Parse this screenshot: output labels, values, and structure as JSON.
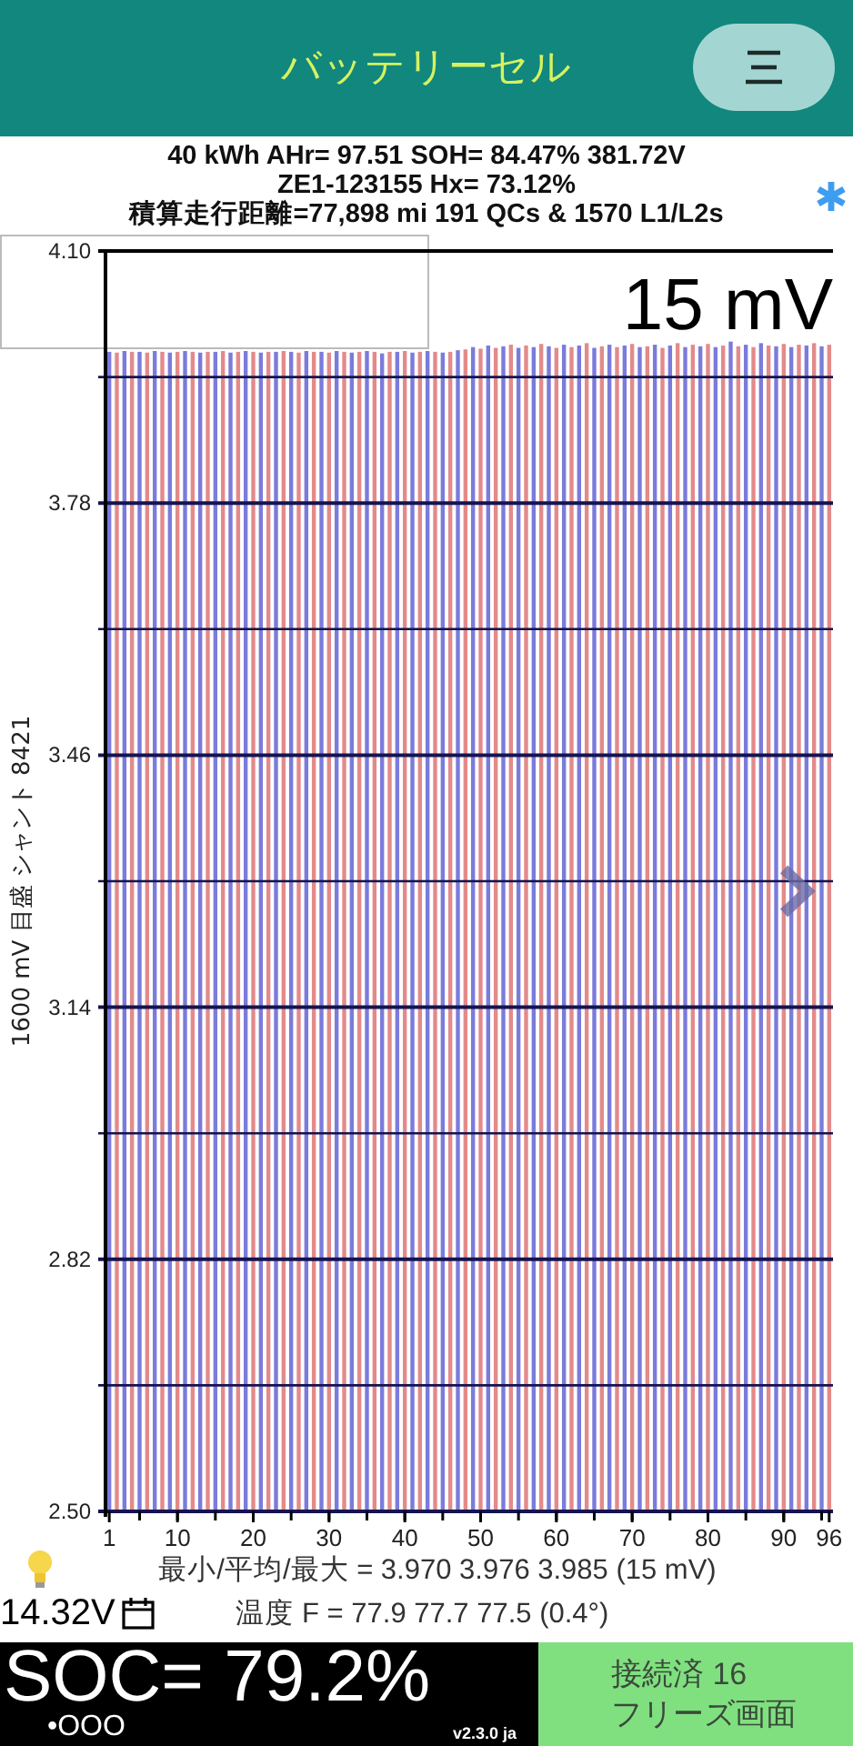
{
  "header": {
    "title": "バッテリーセル"
  },
  "summary": [
    "40 kWh  AHr= 97.51  SOH= 84.47%   381.72V",
    "ZE1-123155   Hx= 73.12%",
    "積算走行距離=77,898 mi 191 QCs & 1570 L1/L2s"
  ],
  "chart": {
    "spread_label": "15 mV",
    "chart_data": {
      "type": "bar",
      "ylabel": "1600 mV 目盛  シャント 8421",
      "grid": true,
      "ref_lines": [
        {
          "axis": "y",
          "value": 2.66
        },
        {
          "axis": "y",
          "value": 2.98
        },
        {
          "axis": "y",
          "value": 3.3
        },
        {
          "axis": "y",
          "value": 3.62
        },
        {
          "axis": "y",
          "value": 3.94
        }
      ],
      "x": [
        1,
        2,
        3,
        4,
        5,
        6,
        7,
        8,
        9,
        10,
        11,
        12,
        13,
        14,
        15,
        16,
        17,
        18,
        19,
        20,
        21,
        22,
        23,
        24,
        25,
        26,
        27,
        28,
        29,
        30,
        31,
        32,
        33,
        34,
        35,
        36,
        37,
        38,
        39,
        40,
        41,
        42,
        43,
        44,
        45,
        46,
        47,
        48,
        49,
        50,
        51,
        52,
        53,
        54,
        55,
        56,
        57,
        58,
        59,
        60,
        61,
        62,
        63,
        64,
        65,
        66,
        67,
        68,
        69,
        70,
        71,
        72,
        73,
        74,
        75,
        76,
        77,
        78,
        79,
        80,
        81,
        82,
        83,
        84,
        85,
        86,
        87,
        88,
        89,
        90,
        91,
        92,
        93,
        94,
        95,
        96
      ],
      "xlim": [
        0.5,
        96.5
      ],
      "ylim": [
        2.5,
        4.1
      ],
      "xticks": [
        1,
        10,
        20,
        30,
        40,
        50,
        60,
        70,
        80,
        90,
        96
      ],
      "yticks": [
        {
          "value": 2.5,
          "label": "2.50"
        },
        {
          "value": 2.82,
          "label": "2.82"
        },
        {
          "value": 3.14,
          "label": "3.14"
        },
        {
          "value": 3.46,
          "label": "3.46"
        },
        {
          "value": 3.78,
          "label": "3.78"
        },
        {
          "value": 4.1,
          "label": "4.10"
        }
      ],
      "series": [
        {
          "color": "#7b7bdc",
          "values": [
            3.972,
            null,
            3.973,
            null,
            3.972,
            null,
            3.973,
            null,
            3.971,
            null,
            3.973,
            null,
            3.971,
            null,
            3.972,
            null,
            3.971,
            null,
            3.973,
            null,
            3.971,
            null,
            3.972,
            null,
            3.972,
            null,
            3.973,
            null,
            3.972,
            null,
            3.973,
            null,
            3.971,
            null,
            3.973,
            null,
            3.97,
            null,
            3.972,
            null,
            3.971,
            null,
            3.973,
            null,
            3.971,
            null,
            3.974,
            null,
            3.978,
            null,
            3.98,
            null,
            3.979,
            null,
            3.977,
            null,
            3.978,
            null,
            3.979,
            null,
            3.981,
            null,
            3.98,
            null,
            3.977,
            null,
            3.981,
            null,
            3.98,
            null,
            3.978,
            null,
            3.981,
            null,
            3.98,
            null,
            3.978,
            null,
            3.979,
            null,
            3.978,
            null,
            3.985,
            null,
            3.981,
            null,
            3.983,
            null,
            3.979,
            null,
            3.978,
            null,
            3.98,
            null,
            3.979,
            null
          ]
        },
        {
          "color": "#e38a8a",
          "values": [
            null,
            3.971,
            null,
            3.972,
            null,
            3.971,
            null,
            3.972,
            null,
            3.972,
            null,
            3.972,
            null,
            3.972,
            null,
            3.973,
            null,
            3.972,
            null,
            3.972,
            null,
            3.972,
            null,
            3.973,
            null,
            3.971,
            null,
            3.972,
            null,
            3.971,
            null,
            3.972,
            null,
            3.972,
            null,
            3.972,
            null,
            3.972,
            null,
            3.973,
            null,
            3.972,
            null,
            3.972,
            null,
            3.972,
            null,
            3.975,
            null,
            3.976,
            null,
            3.977,
            null,
            3.981,
            null,
            3.98,
            null,
            3.982,
            null,
            3.977,
            null,
            3.978,
            null,
            3.983,
            null,
            3.979,
            null,
            3.978,
            null,
            3.982,
            null,
            3.979,
            null,
            3.977,
            null,
            3.983,
            null,
            3.981,
            null,
            3.982,
            null,
            3.98,
            null,
            3.979,
            null,
            3.978,
            null,
            3.98,
            null,
            3.982,
            null,
            3.981,
            null,
            3.983,
            null,
            3.981
          ]
        }
      ]
    }
  },
  "stats": [
    "最小/平均/最大 = 3.970 3.976 3.985  (15 mV)",
    "温度 F = 77.9  77.7  77.5  (0.4°)"
  ],
  "aux_voltage": "14.32V",
  "soc": "SOC= 79.2%",
  "page_dots": "•OOO",
  "version": "v2.3.0 ja",
  "status": [
    "接続済 16",
    "フリーズ画面"
  ]
}
